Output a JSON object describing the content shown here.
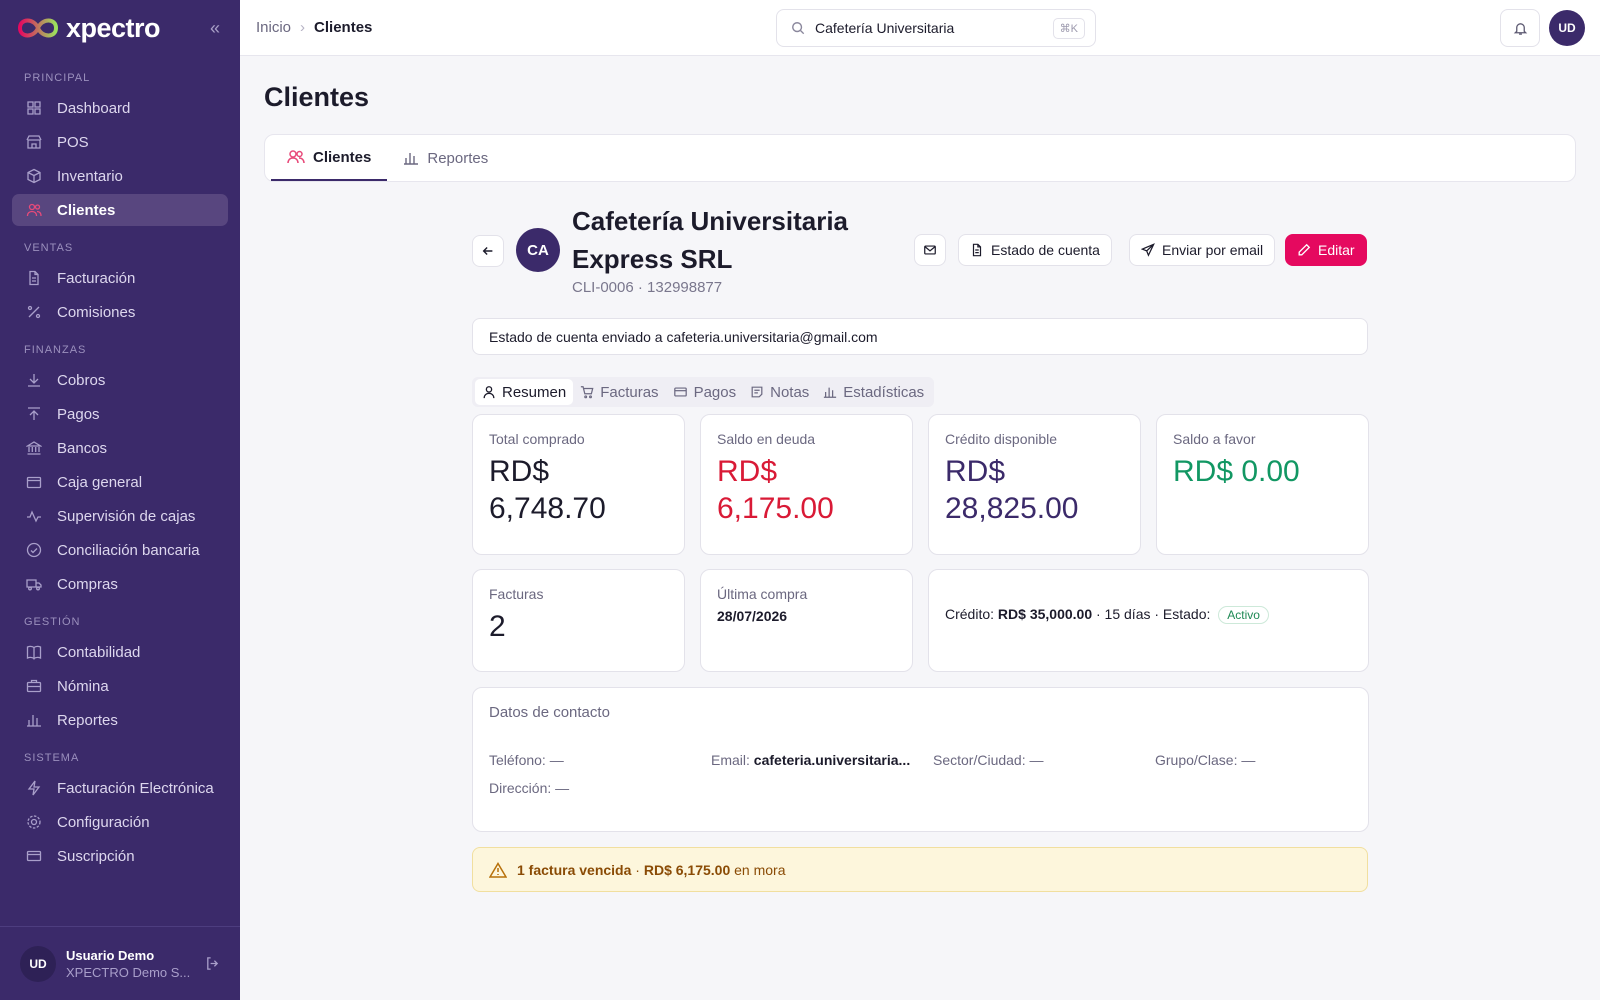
{
  "app": {
    "name": "xpectro"
  },
  "sidebar": {
    "sections": [
      {
        "label": "PRINCIPAL",
        "items": [
          {
            "label": "Dashboard",
            "icon": "grid-icon"
          },
          {
            "label": "POS",
            "icon": "store-icon"
          },
          {
            "label": "Inventario",
            "icon": "box-icon"
          },
          {
            "label": "Clientes",
            "icon": "users-icon",
            "active": true
          }
        ]
      },
      {
        "label": "VENTAS",
        "items": [
          {
            "label": "Facturación",
            "icon": "file-icon"
          },
          {
            "label": "Comisiones",
            "icon": "percent-icon"
          }
        ]
      },
      {
        "label": "FINANZAS",
        "items": [
          {
            "label": "Cobros",
            "icon": "download-icon"
          },
          {
            "label": "Pagos",
            "icon": "upload-icon"
          },
          {
            "label": "Bancos",
            "icon": "bank-icon"
          },
          {
            "label": "Caja general",
            "icon": "wallet-icon"
          },
          {
            "label": "Supervisión de cajas",
            "icon": "activity-icon"
          },
          {
            "label": "Conciliación bancaria",
            "icon": "check-circle-icon"
          },
          {
            "label": "Compras",
            "icon": "truck-icon"
          }
        ]
      },
      {
        "label": "GESTIÓN",
        "items": [
          {
            "label": "Contabilidad",
            "icon": "book-icon"
          },
          {
            "label": "Nómina",
            "icon": "briefcase-icon"
          },
          {
            "label": "Reportes",
            "icon": "bar-chart-icon"
          }
        ]
      },
      {
        "label": "SISTEMA",
        "items": [
          {
            "label": "Facturación Electrónica",
            "icon": "zap-icon"
          },
          {
            "label": "Configuración",
            "icon": "gear-icon"
          },
          {
            "label": "Suscripción",
            "icon": "credit-card-icon"
          }
        ]
      }
    ],
    "user": {
      "initials": "UD",
      "name": "Usuario Demo",
      "org": "XPECTRO Demo S..."
    }
  },
  "topbar": {
    "breadcrumb": [
      "Inicio",
      "Clientes"
    ],
    "search": {
      "value": "Cafetería Universitaria",
      "shortcut": "⌘K"
    },
    "avatar": "UD"
  },
  "page": {
    "title": "Clientes",
    "tabs": [
      {
        "label": "Clientes",
        "active": true
      },
      {
        "label": "Reportes"
      }
    ]
  },
  "client": {
    "initials": "CA",
    "name": "Cafetería Universitaria Express SRL",
    "sub": "CLI-0006 · 132998877",
    "actions": {
      "estado": "Estado de cuenta",
      "enviar": "Enviar por email",
      "editar": "Editar"
    },
    "notice": "Estado de cuenta enviado a cafeteria.universitaria@gmail.com",
    "subtabs": [
      {
        "label": "Resumen",
        "active": true
      },
      {
        "label": "Facturas"
      },
      {
        "label": "Pagos"
      },
      {
        "label": "Notas"
      },
      {
        "label": "Estadísticas"
      }
    ],
    "kpis": [
      {
        "label": "Total comprado",
        "value": "RD$ 6,748.70",
        "color": "#1c1b2b"
      },
      {
        "label": "Saldo en deuda",
        "value": "RD$ 6,175.00",
        "color": "#d91a36"
      },
      {
        "label": "Crédito disponible",
        "value": "RD$ 28,825.00",
        "color": "#3b2a6a"
      },
      {
        "label": "Saldo a favor",
        "value": "RD$ 0.00",
        "color": "#129763"
      }
    ],
    "facturas": {
      "label": "Facturas",
      "value": "2"
    },
    "ultima_compra": {
      "label": "Última compra",
      "value": "28/07/2026"
    },
    "credito": {
      "prefix": "Crédito:",
      "amount": "RD$ 35,000.00",
      "terms": "· 15 días · Estado:",
      "status": "Activo"
    },
    "contacto": {
      "title": "Datos de contacto",
      "telefono": {
        "label": "Teléfono:",
        "value": "—"
      },
      "email": {
        "label": "Email:",
        "value": "cafeteria.universitaria..."
      },
      "sector": {
        "label": "Sector/Ciudad:",
        "value": "—"
      },
      "grupo": {
        "label": "Grupo/Clase:",
        "value": "—"
      },
      "direccion": {
        "label": "Dirección:",
        "value": "—"
      }
    },
    "alert": {
      "count": "1 factura vencida",
      "dot": "·",
      "amount": "RD$ 6,175.00",
      "suffix": "en mora"
    }
  }
}
